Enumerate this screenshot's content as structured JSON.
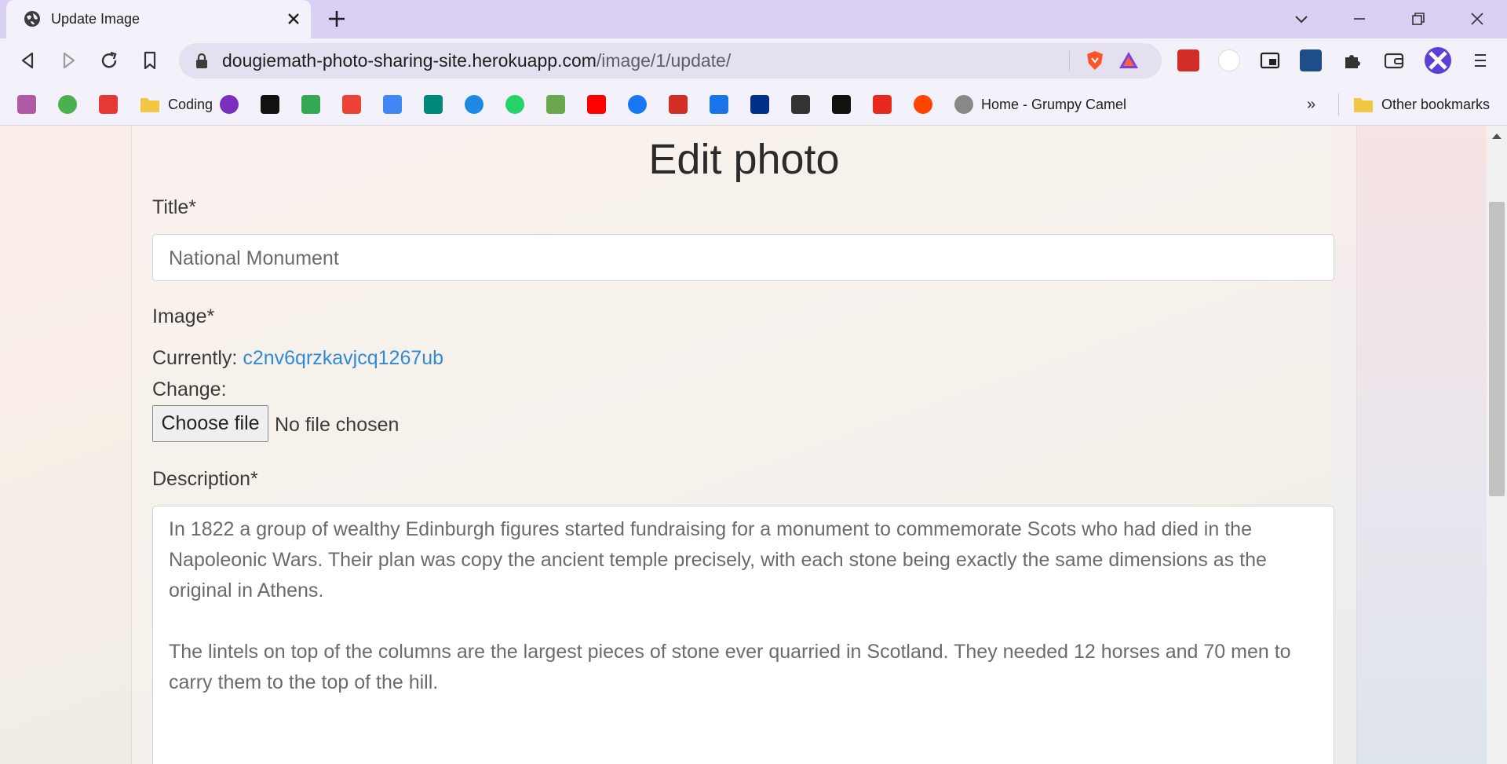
{
  "browser": {
    "tab_title": "Update Image",
    "url_host": "dougiemath-photo-sharing-site.herokuapp.com",
    "url_path": "/image/1/update/",
    "bookmarks": [
      {
        "label": "",
        "icon": "site-icon",
        "color": "#b05aa6"
      },
      {
        "label": "",
        "icon": "edge-like-icon",
        "color": "#4caf50"
      },
      {
        "label": "",
        "icon": "chat-icon",
        "color": "#e53935"
      },
      {
        "label": "Coding",
        "icon": "folder-icon",
        "color": "#f2c744"
      },
      {
        "label": "",
        "icon": "purple-circle-icon",
        "color": "#7b2fbf"
      },
      {
        "label": "",
        "icon": "amazon-icon",
        "color": "#111111"
      },
      {
        "label": "",
        "icon": "drive-icon",
        "color": "#34a853"
      },
      {
        "label": "",
        "icon": "gmail-icon",
        "color": "#ea4335"
      },
      {
        "label": "",
        "icon": "calendar-icon",
        "color": "#4285f4"
      },
      {
        "label": "",
        "icon": "meet-icon",
        "color": "#00897b"
      },
      {
        "label": "",
        "icon": "onedrive-icon",
        "color": "#1e88e5"
      },
      {
        "label": "",
        "icon": "whatsapp-icon",
        "color": "#25d366"
      },
      {
        "label": "",
        "icon": "app-a-icon",
        "color": "#6aa84f"
      },
      {
        "label": "",
        "icon": "youtube-icon",
        "color": "#ff0000"
      },
      {
        "label": "",
        "icon": "facebook-icon",
        "color": "#1877f2"
      },
      {
        "label": "",
        "icon": "lastpass-icon",
        "color": "#d32d27"
      },
      {
        "label": "",
        "icon": "translate-icon",
        "color": "#1a73e8"
      },
      {
        "label": "",
        "icon": "paypal-icon",
        "color": "#003087"
      },
      {
        "label": "",
        "icon": "grid-icon",
        "color": "#333333"
      },
      {
        "label": "",
        "icon": "dots-icon",
        "color": "#111111"
      },
      {
        "label": "",
        "icon": "ted-icon",
        "color": "#e62b1e"
      },
      {
        "label": "",
        "icon": "reddit-icon",
        "color": "#ff4500"
      },
      {
        "label": "Home - Grumpy Camel",
        "icon": "camel-icon",
        "color": "#888888"
      }
    ],
    "other_bookmarks": "Other bookmarks",
    "more_bookmarks": "»"
  },
  "page": {
    "heading": "Edit photo",
    "title_label": "Title*",
    "title_value": "National Monument",
    "image_label": "Image*",
    "currently_label": "Currently:",
    "current_file": "c2nv6qrzkavjcq1267ub",
    "change_label": "Change:",
    "choose_file": "Choose file",
    "no_file": "No file chosen",
    "description_label": "Description*",
    "description_value": "In 1822 a group of wealthy Edinburgh figures started fundraising for a monument to commemorate Scots who had died in the Napoleonic Wars. Their plan was copy the ancient temple precisely, with each stone being exactly the same dimensions as the original in Athens.\n\nThe lintels on top of the columns are the largest pieces of stone ever quarried in Scotland. They needed 12 horses and 70 men to carry them to the top of the hill."
  }
}
